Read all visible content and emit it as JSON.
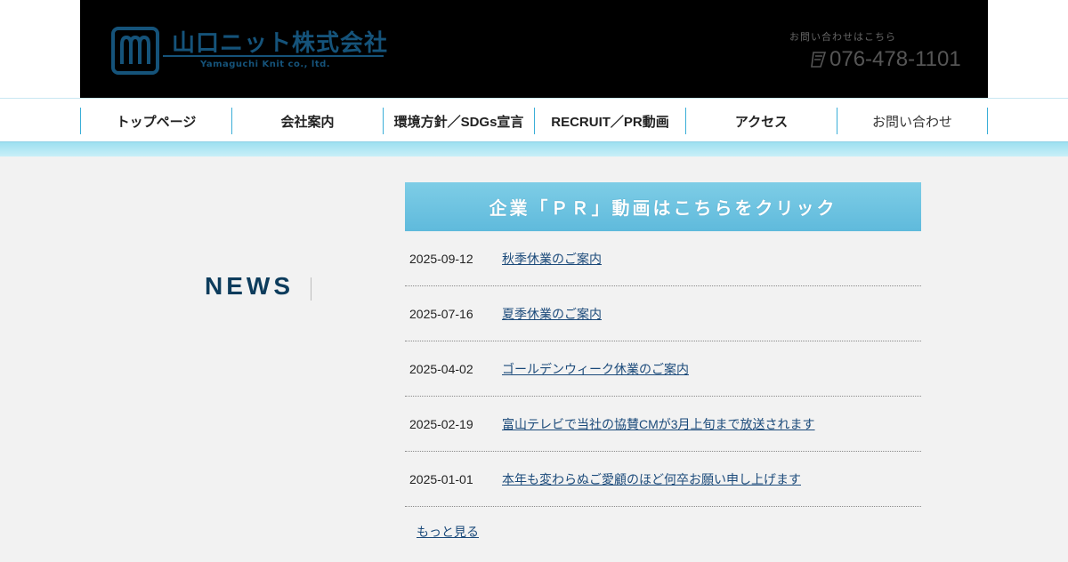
{
  "header": {
    "logo_text": "山口ニット株式会社",
    "logo_sub": "Yamaguchi Knit co., ltd.",
    "contact_label": "お問い合わせはこちら",
    "phone": "076-478-1101"
  },
  "nav": {
    "items": [
      {
        "label": "トップページ"
      },
      {
        "label": "会社案内"
      },
      {
        "label": "環境方針／SDGs宣言"
      },
      {
        "label": "RECRUIT／PR動画"
      },
      {
        "label": "アクセス"
      },
      {
        "label": "お問い合わせ"
      }
    ]
  },
  "news": {
    "title": "NEWS",
    "banner": "企業「ＰＲ」動画はこちらをクリック",
    "items": [
      {
        "date": "2025-09-12",
        "title": "秋季休業のご案内"
      },
      {
        "date": "2025-07-16",
        "title": "夏季休業のご案内"
      },
      {
        "date": "2025-04-02",
        "title": "ゴールデンウィーク休業のご案内"
      },
      {
        "date": "2025-02-19",
        "title": "富山テレビで当社の協賛CMが3月上旬まで放送されます"
      },
      {
        "date": "2025-01-01",
        "title": "本年も変わらぬご愛顧のほど何卒お願い申し上げます"
      }
    ],
    "more": "もっと見る"
  },
  "colors": {
    "header_bg": "#000000",
    "logo": "#15537a",
    "nav_divider": "#3aaed8",
    "banner": "#6cc4e2",
    "news_title": "#0d3c5c",
    "link": "#1b4a7a"
  },
  "icons": {
    "logo_mark": "knit-logo-icon",
    "phone": "phone-icon"
  }
}
